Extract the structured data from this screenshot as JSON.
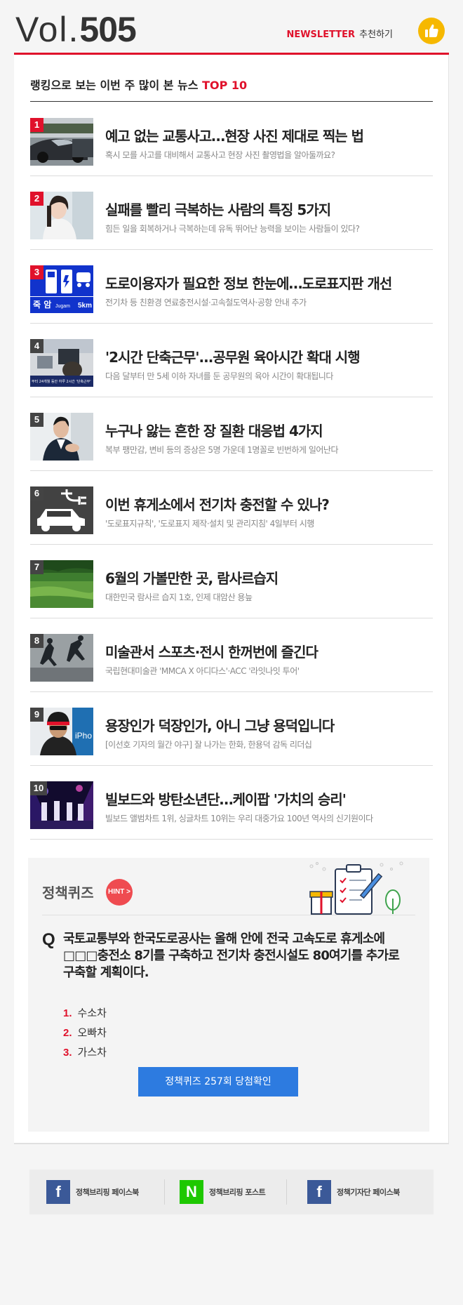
{
  "header": {
    "vol_label": "Vol.",
    "vol_number": "505",
    "newsletter_brand": "NEWSLETTER",
    "newsletter_recommend": "추천하기"
  },
  "ranking": {
    "title_prefix": "랭킹으로 보는 이번 주 많이 본 뉴스 ",
    "title_accent": "TOP 10",
    "items": [
      {
        "rank": "1",
        "title": "예고 없는 교통사고…현장 사진 제대로 찍는 법",
        "subtitle": "혹시 모를 사고를 대비해서 교통사고 현장 사진 촬영법을 알아둘까요?"
      },
      {
        "rank": "2",
        "title": "실패를 빨리 극복하는 사람의 특징 5가지",
        "subtitle": "힘든 일을 회복하거나 극복하는데 유독 뛰어난 능력을 보이는 사람들이 있다?"
      },
      {
        "rank": "3",
        "title": "도로이용자가 필요한 정보 한눈에…도로표지판 개선",
        "subtitle": "전기차 등 친환경 연료충전시설·고속철도역사·공항 안내 추가",
        "thumb_text": "죽 암",
        "thumb_text2": "Jugam",
        "thumb_text3": "5km"
      },
      {
        "rank": "4",
        "title": "'2시간 단축근무'...공무원 육아시간 확대 시행",
        "subtitle": "다음 달부터 만 5세 이하 자녀를 둔 공무원의 육아 시간이 확대됩니다",
        "thumb_text": "부터 24개월 동안 하루 2시간 '단축근무'"
      },
      {
        "rank": "5",
        "title": "누구나 앓는 흔한 장 질환 대응법 4가지",
        "subtitle": "복부 팽만감, 변비 등의 증상은 5명 가운데 1명꼴로 빈번하게 일어난다"
      },
      {
        "rank": "6",
        "title": "이번 휴게소에서 전기차 충전할 수 있나?",
        "subtitle": "'도로표지규칙', '도로표지 제작·설치 및 관리지침' 4일부터 시행"
      },
      {
        "rank": "7",
        "title": "6월의 가볼만한 곳, 람사르습지",
        "subtitle": "대한민국 람사르 습지 1호, 인제 대암산 용늪"
      },
      {
        "rank": "8",
        "title": "미술관서 스포츠·전시 한꺼번에 즐긴다",
        "subtitle": "국립현대미술관 'MMCA X 아디다스'·ACC '라잇나잇 투어'"
      },
      {
        "rank": "9",
        "title": "용장인가 덕장인가, 아니 그냥 용덕입니다",
        "subtitle": "[이선호 기자의 월간 야구] 잘 나가는 한화, 한용덕 감독 리더십",
        "thumb_text": "iPho"
      },
      {
        "rank": "10",
        "title": "빌보드와 방탄소년단…케이팝 '가치의 승리'",
        "subtitle": "빌보드 앨범차트 1위, 싱글차트 10위는 우리 대중가요 100년 역사의 신기원이다"
      }
    ]
  },
  "quiz": {
    "title": "정책퀴즈",
    "hint_label": "HINT >",
    "q_mark": "Q",
    "question": "국토교통부와 한국도로공사는 올해 안에 전국 고속도로 휴게소에 □□□충전소 8기를 구축하고 전기차 충전시설도 80여기를 추가로 구축할 계획이다.",
    "options": [
      {
        "num": "1.",
        "label": "수소차"
      },
      {
        "num": "2.",
        "label": "오빠차"
      },
      {
        "num": "3.",
        "label": "가스차"
      }
    ],
    "button_label": "정책퀴즈 257회 당첨확인"
  },
  "footer": {
    "links": [
      {
        "icon": "facebook-icon",
        "glyph": "f",
        "label": "정책브리핑 페이스북"
      },
      {
        "icon": "naver-post-icon",
        "glyph": "N",
        "label": "정책브리핑 포스트"
      },
      {
        "icon": "facebook-icon",
        "glyph": "f",
        "label": "정책기자단 페이스북"
      }
    ]
  },
  "colors": {
    "accent_red": "#e0112b",
    "button_blue": "#2d7be0",
    "facebook_blue": "#3b5998",
    "naver_green": "#1ec800",
    "thumb_yellow": "#f6b800",
    "hint_red": "#ef4b50"
  }
}
